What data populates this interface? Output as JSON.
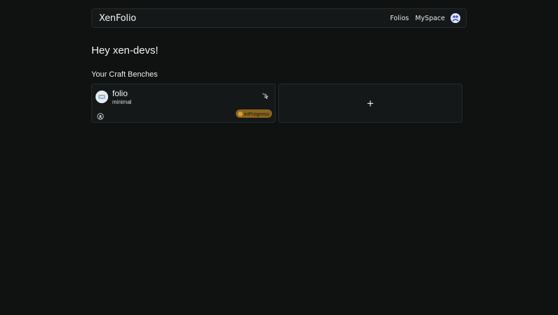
{
  "nav": {
    "brand": "XenFolio",
    "links": [
      "Folios",
      "MySpace"
    ],
    "avatar_icon": "user-avatar-icon"
  },
  "greeting": "Hey xen-devs!",
  "section_title": "Your Craft Benches",
  "benches": [
    {
      "name": "folio",
      "theme": "minimal",
      "status": "inProgress",
      "status_color": "#8a6421",
      "icons": [
        "project-logo-icon",
        "edit-icon",
        "github-icon"
      ]
    }
  ],
  "add_card": {
    "label": "+"
  },
  "colors": {
    "background": "#101212",
    "card": "#151818",
    "border": "#262a2a",
    "status_in_progress": "#d59d31"
  }
}
